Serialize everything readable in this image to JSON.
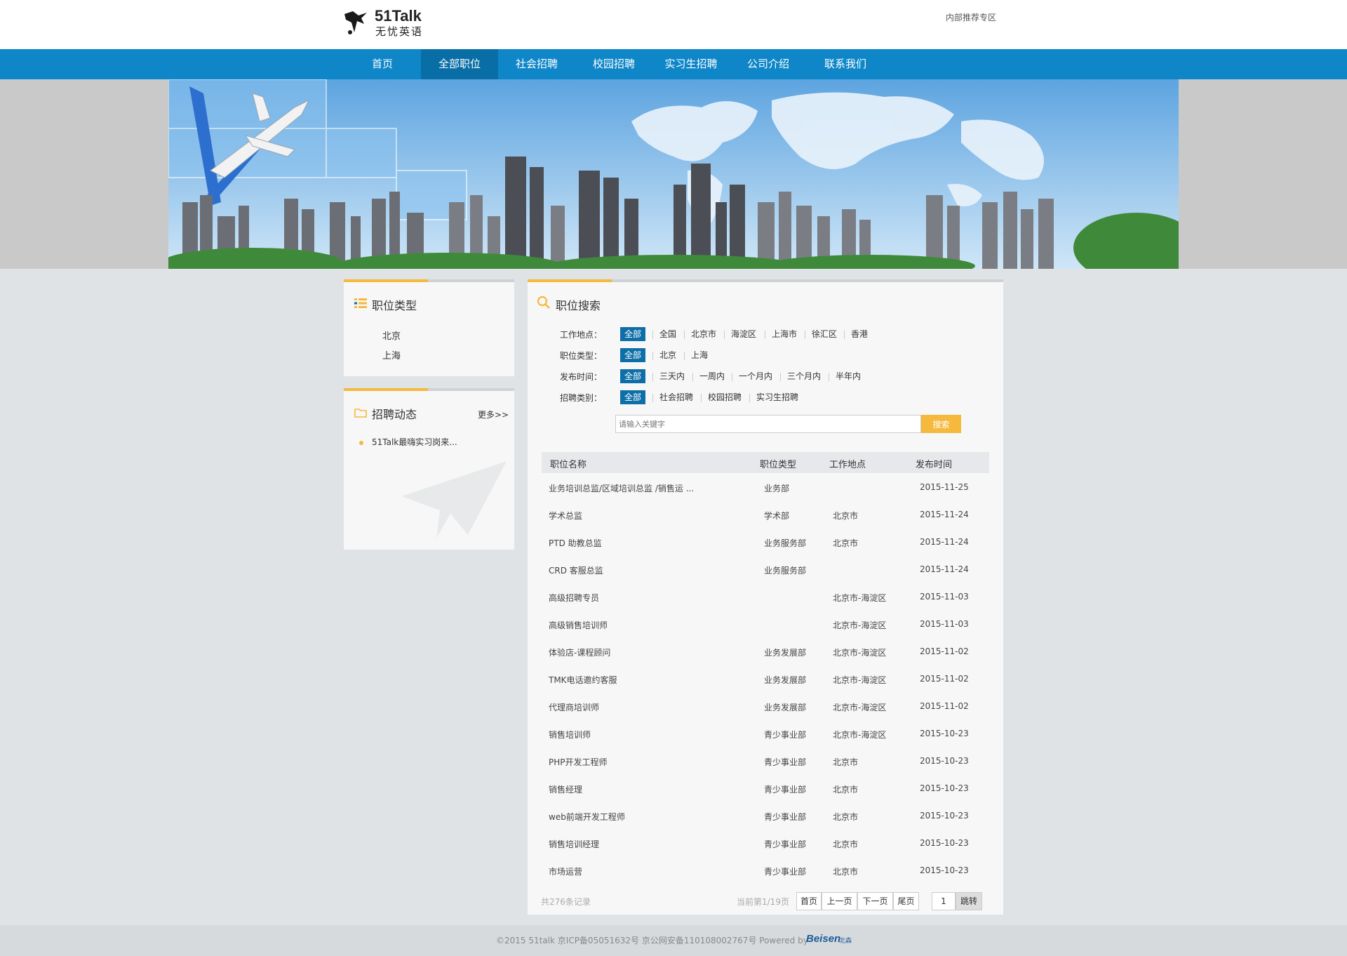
{
  "header": {
    "logo_title": "51Talk",
    "logo_subtitle": "无忧英语",
    "internal_link": "内部推荐专区"
  },
  "nav": {
    "items": [
      {
        "label": "首页",
        "active": false
      },
      {
        "label": "全部职位",
        "active": true
      },
      {
        "label": "社会招聘",
        "active": false
      },
      {
        "label": "校园招聘",
        "active": false
      },
      {
        "label": "实习生招聘",
        "active": false
      },
      {
        "label": "公司介绍",
        "active": false
      },
      {
        "label": "联系我们",
        "active": false
      }
    ]
  },
  "sidebar": {
    "category_title": "职位类型",
    "categories": [
      "北京",
      "上海"
    ],
    "news_title": "招聘动态",
    "news_more": "更多>>",
    "news_items": [
      "51Talk最嗨实习岗来..."
    ]
  },
  "search": {
    "title": "职位搜索",
    "filters": [
      {
        "label": "工作地点：",
        "options": [
          "全部",
          "全国",
          "北京市",
          "海淀区",
          "上海市",
          "徐汇区",
          "香港"
        ]
      },
      {
        "label": "职位类型：",
        "options": [
          "全部",
          "北京",
          "上海"
        ]
      },
      {
        "label": "发布时间：",
        "options": [
          "全部",
          "三天内",
          "一周内",
          "一个月内",
          "三个月内",
          "半年内"
        ]
      },
      {
        "label": "招聘类别：",
        "options": [
          "全部",
          "社会招聘",
          "校园招聘",
          "实习生招聘"
        ]
      }
    ],
    "placeholder": "请输入关键字",
    "button": "搜索"
  },
  "table": {
    "headers": [
      "职位名称",
      "职位类型",
      "工作地点",
      "发布时间"
    ],
    "rows": [
      [
        "业务培训总监/区域培训总监 /销售运 ...",
        "业务部",
        "",
        "2015-11-25"
      ],
      [
        "学术总监",
        "学术部",
        "北京市",
        "2015-11-24"
      ],
      [
        "PTD 助教总监",
        "业务服务部",
        "北京市",
        "2015-11-24"
      ],
      [
        "CRD 客服总监",
        "业务服务部",
        "",
        "2015-11-24"
      ],
      [
        "高级招聘专员",
        "",
        "北京市-海淀区",
        "2015-11-03"
      ],
      [
        "高级销售培训师",
        "",
        "北京市-海淀区",
        "2015-11-03"
      ],
      [
        "体验店-课程顾问",
        "业务发展部",
        "北京市-海淀区",
        "2015-11-02"
      ],
      [
        "TMK电话邀约客服",
        "业务发展部",
        "北京市-海淀区",
        "2015-11-02"
      ],
      [
        "代理商培训师",
        "业务发展部",
        "北京市-海淀区",
        "2015-11-02"
      ],
      [
        "销售培训师",
        "青少事业部",
        "北京市-海淀区",
        "2015-10-23"
      ],
      [
        "PHP开发工程师",
        "青少事业部",
        "北京市",
        "2015-10-23"
      ],
      [
        "销售经理",
        "青少事业部",
        "北京市",
        "2015-10-23"
      ],
      [
        "web前端开发工程师",
        "青少事业部",
        "北京市",
        "2015-10-23"
      ],
      [
        "销售培训经理",
        "青少事业部",
        "北京市",
        "2015-10-23"
      ],
      [
        "市场运营",
        "青少事业部",
        "北京市",
        "2015-10-23"
      ]
    ]
  },
  "pager": {
    "total": "共276条记录",
    "current": "当前第1/19页",
    "first": "首页",
    "prev": "上一页",
    "next": "下一页",
    "last": "尾页",
    "page_value": "1",
    "go": "跳转"
  },
  "footer": {
    "text": "©2015 51talk 京ICP备05051632号 京公网安备110108002767号 Powered by",
    "brand": "Beisen",
    "brand_cn": "北森"
  },
  "colors": {
    "nav_bg": "#0e86c8",
    "nav_active": "#0a6ea6",
    "accent": "#f5b93d",
    "filter_active": "#0e6fa8"
  }
}
